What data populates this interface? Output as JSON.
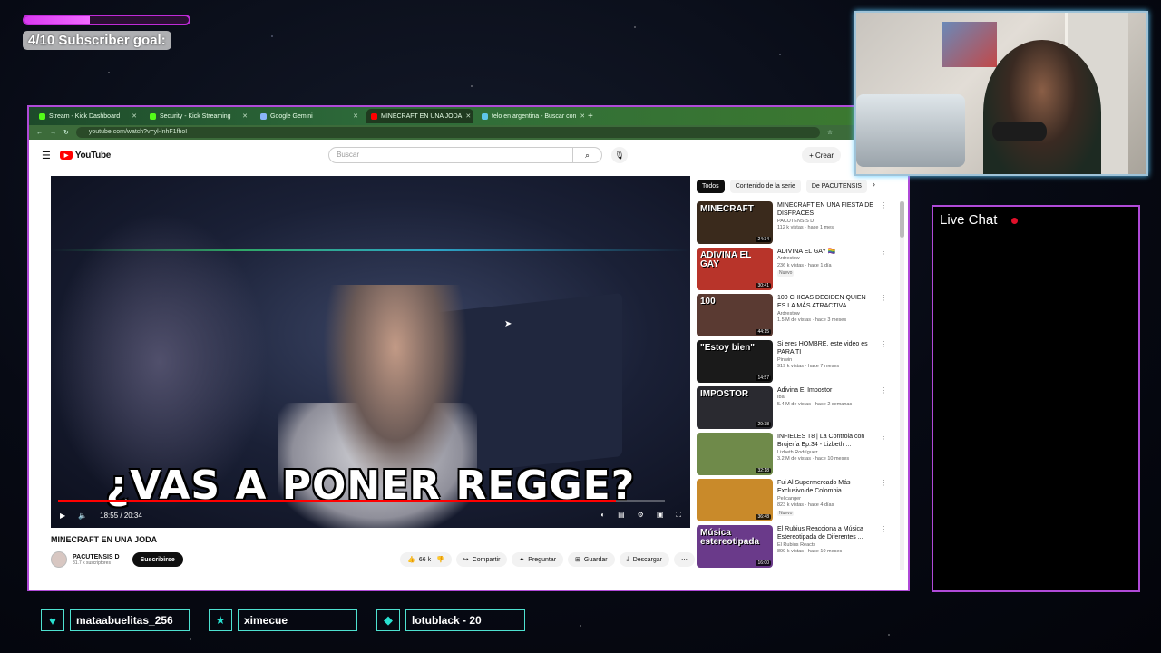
{
  "sub_goal": {
    "label": "4/10 Subscriber goal:",
    "progress": 0.4
  },
  "browser": {
    "tabs": [
      {
        "label": "Stream - Kick Dashboard",
        "active": false,
        "favicon_color": "#53fc18"
      },
      {
        "label": "Security - Kick Streaming",
        "active": false,
        "favicon_color": "#53fc18"
      },
      {
        "label": "Google Gemini",
        "active": false,
        "favicon_color": "#8ab4f8"
      },
      {
        "label": "MINECRAFT EN UNA JODA",
        "active": true,
        "favicon_color": "#ff0000"
      },
      {
        "label": "telo en argentina - Buscar con",
        "active": false,
        "favicon_color": "#5ec6e8"
      }
    ],
    "url": "youtube.com/watch?v=yl-lnhF1fhoI"
  },
  "youtube": {
    "logo": "YouTube",
    "search_placeholder": "Buscar",
    "create_label": "Crear",
    "video": {
      "caption": "¿VAS A PONER REGGE?",
      "time": "18:55 / 20:34",
      "progress": 0.92,
      "title": "MINECRAFT EN UNA JODA"
    },
    "channel": {
      "name": "PACUTENSIS D",
      "subs": "81.7 k suscriptores",
      "subscribe_label": "Suscribirse"
    },
    "actions": {
      "likes": "66 k",
      "share": "Compartir",
      "ask": "Preguntar",
      "save": "Guardar",
      "download": "Descargar"
    },
    "chips": [
      "Todos",
      "Contenido de la serie",
      "De PACUTENSIS"
    ],
    "recommendations": [
      {
        "title": "MINECRAFT EN UNA FIESTA DE DISFRACES",
        "channel": "PACUTENSIS D",
        "meta": "112 k vistas · hace 1 mes",
        "duration": "24:34",
        "thumb_text": "MINECRAFT",
        "thumb_color": "#3a2a1c",
        "badge": ""
      },
      {
        "title": "ADIVINA EL GAY 🏳️‍🌈",
        "channel": "Ardrestow",
        "meta": "236 k vistas · hace 1 día",
        "duration": "30:41",
        "thumb_text": "ADIVINA EL GAY",
        "thumb_color": "#b8342a",
        "badge": "Nuevo"
      },
      {
        "title": "100 CHICAS DECIDEN QUIEN ES LA MÁS ATRACTIVA",
        "channel": "Ardrestow",
        "meta": "1.5 M de vistas · hace 3 meses",
        "duration": "44:15",
        "thumb_text": "100",
        "thumb_color": "#5a3a32",
        "badge": ""
      },
      {
        "title": "Si eres HOMBRE, este video es PARA TI",
        "channel": "Pinwin",
        "meta": "919 k vistas · hace 7 meses",
        "duration": "14:57",
        "thumb_text": "\"Estoy bien\"",
        "thumb_color": "#1a1a1a",
        "badge": ""
      },
      {
        "title": "Adivina El Impostor",
        "channel": "Ibai",
        "meta": "5.4 M de vistas · hace 2 semanas",
        "duration": "29:38",
        "thumb_text": "IMPOSTOR",
        "thumb_color": "#2a2a30",
        "badge": ""
      },
      {
        "title": "INFIELES T8 | La Controla con Brujería Ep.34 - Lizbeth ...",
        "channel": "Lizbeth Rodríguez",
        "meta": "3.2 M de vistas · hace 10 meses",
        "duration": "32:18",
        "thumb_text": "",
        "thumb_color": "#6f8a4a",
        "badge": ""
      },
      {
        "title": "Fui Al Supermercado Más Exclusivo de Colombia",
        "channel": "Pelicanger",
        "meta": "823 k vistas · hace 4 días",
        "duration": "36:48",
        "thumb_text": "",
        "thumb_color": "#c98a2a",
        "badge": "Nuevo"
      },
      {
        "title": "El Rubius Reacciona a Música Estereotipada de Diferentes ...",
        "channel": "El Rubius Reacts",
        "meta": "899 k vistas · hace 10 meses",
        "duration": "16:00",
        "thumb_text": "Música estereotipada",
        "thumb_color": "#6a3a8a",
        "badge": ""
      }
    ]
  },
  "live_chat": {
    "title": "Live Chat"
  },
  "credits": [
    {
      "name": "mataabuelitas_256",
      "icon": "heart-icon",
      "glyph": "♥"
    },
    {
      "name": "ximecue",
      "icon": "star-icon",
      "glyph": "★"
    },
    {
      "name": "lotublack - 20",
      "icon": "drop-icon",
      "glyph": "◆"
    }
  ],
  "colors": {
    "frame": "#b04ad8",
    "accent_teal": "#4ee1d0",
    "yt_red": "#ff0000",
    "sub_bar": "#d93af0"
  }
}
